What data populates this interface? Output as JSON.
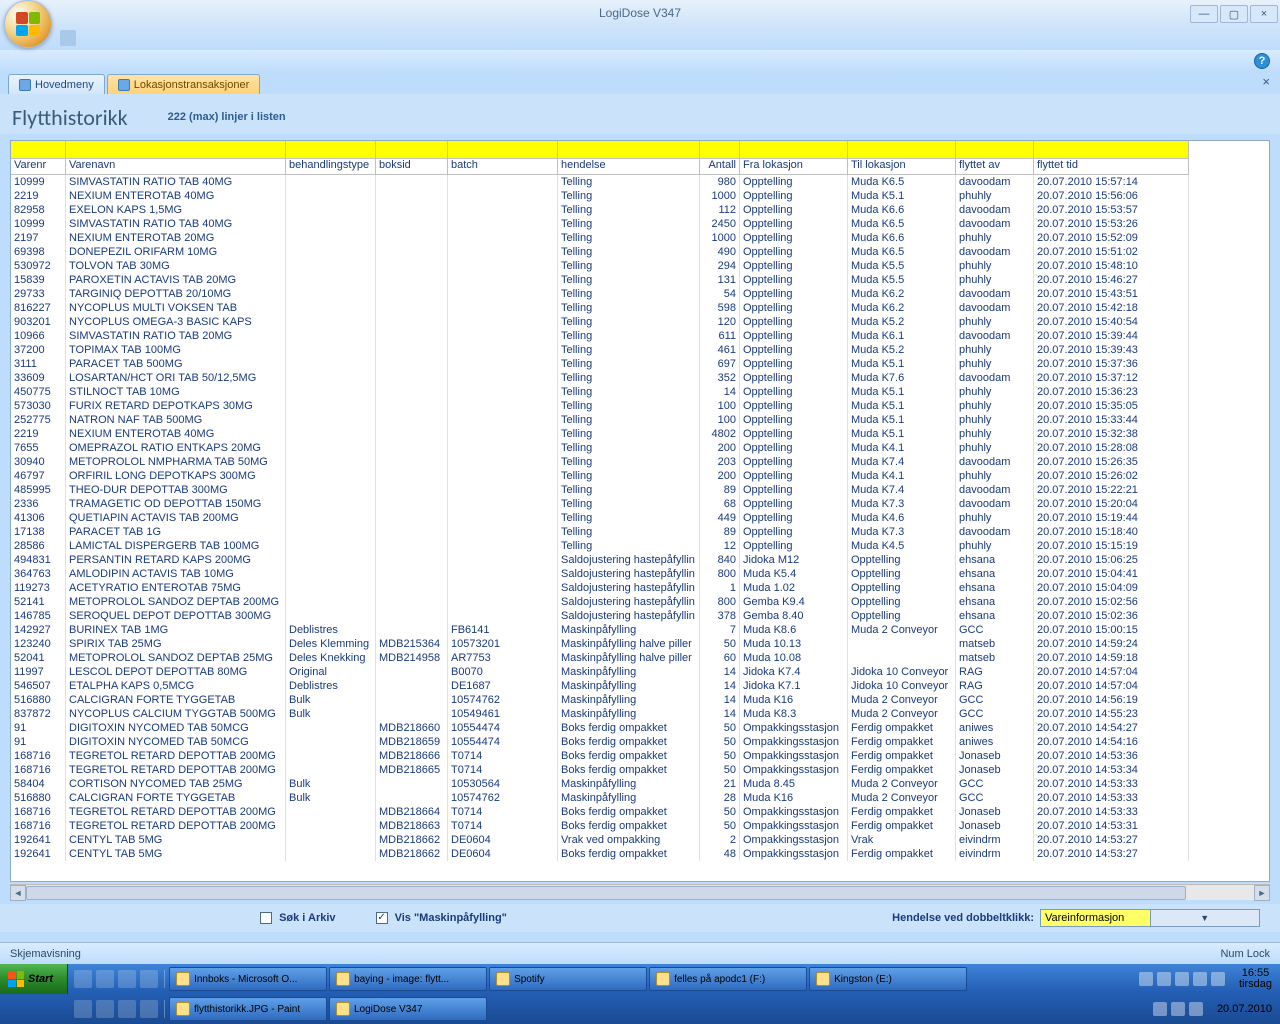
{
  "window": {
    "app_title": "LogiDose V347",
    "min": "—",
    "max": "▢",
    "close": "×",
    "help": "?"
  },
  "tabs": {
    "inactive": "Hovedmeny",
    "active": "Lokasjonstransaksjoner",
    "close": "×"
  },
  "heading": {
    "title": "Flytthistorikk",
    "subtitle": "222 (max) linjer i listen"
  },
  "columns": [
    "Varenr",
    "Varenavn",
    "behandlingstype",
    "boksid",
    "batch",
    "hendelse",
    "Antall",
    "Fra lokasjon",
    "Til lokasjon",
    "flyttet av",
    "flyttet tid"
  ],
  "rows": [
    [
      "10999",
      "SIMVASTATIN RATIO TAB 40MG",
      "",
      "",
      "",
      "Telling",
      "980",
      "Opptelling",
      "Muda K6.5",
      "davoodam",
      "20.07.2010 15:57:14"
    ],
    [
      "2219",
      "NEXIUM ENTEROTAB 40MG",
      "",
      "",
      "",
      "Telling",
      "1000",
      "Opptelling",
      "Muda K5.1",
      "phuhly",
      "20.07.2010 15:56:06"
    ],
    [
      "82958",
      "EXELON KAPS 1,5MG",
      "",
      "",
      "",
      "Telling",
      "112",
      "Opptelling",
      "Muda K6.6",
      "davoodam",
      "20.07.2010 15:53:57"
    ],
    [
      "10999",
      "SIMVASTATIN RATIO TAB 40MG",
      "",
      "",
      "",
      "Telling",
      "2450",
      "Opptelling",
      "Muda K6.5",
      "davoodam",
      "20.07.2010 15:53:26"
    ],
    [
      "2197",
      "NEXIUM ENTEROTAB 20MG",
      "",
      "",
      "",
      "Telling",
      "1000",
      "Opptelling",
      "Muda K6.6",
      "phuhly",
      "20.07.2010 15:52:09"
    ],
    [
      "69398",
      "DONEPEZIL ORIFARM 10MG",
      "",
      "",
      "",
      "Telling",
      "490",
      "Opptelling",
      "Muda K6.5",
      "davoodam",
      "20.07.2010 15:51:02"
    ],
    [
      "530972",
      "TOLVON TAB 30MG",
      "",
      "",
      "",
      "Telling",
      "294",
      "Opptelling",
      "Muda K5.5",
      "phuhly",
      "20.07.2010 15:48:10"
    ],
    [
      "15839",
      "PAROXETIN ACTAVIS TAB 20MG",
      "",
      "",
      "",
      "Telling",
      "131",
      "Opptelling",
      "Muda K5.5",
      "phuhly",
      "20.07.2010 15:46:27"
    ],
    [
      "29733",
      "TARGINIQ DEPOTTAB 20/10MG",
      "",
      "",
      "",
      "Telling",
      "54",
      "Opptelling",
      "Muda K6.2",
      "davoodam",
      "20.07.2010 15:43:51"
    ],
    [
      "816227",
      "NYCOPLUS MULTI VOKSEN TAB",
      "",
      "",
      "",
      "Telling",
      "598",
      "Opptelling",
      "Muda K6.2",
      "davoodam",
      "20.07.2010 15:42:18"
    ],
    [
      "903201",
      "NYCOPLUS OMEGA-3 BASIC KAPS",
      "",
      "",
      "",
      "Telling",
      "120",
      "Opptelling",
      "Muda K5.2",
      "phuhly",
      "20.07.2010 15:40:54"
    ],
    [
      "10966",
      "SIMVASTATIN RATIO TAB 20MG",
      "",
      "",
      "",
      "Telling",
      "611",
      "Opptelling",
      "Muda K6.1",
      "davoodam",
      "20.07.2010 15:39:44"
    ],
    [
      "37200",
      "TOPIMAX TAB 100MG",
      "",
      "",
      "",
      "Telling",
      "461",
      "Opptelling",
      "Muda K5.2",
      "phuhly",
      "20.07.2010 15:39:43"
    ],
    [
      "3111",
      "PARACET TAB  500MG",
      "",
      "",
      "",
      "Telling",
      "697",
      "Opptelling",
      "Muda K5.1",
      "phuhly",
      "20.07.2010 15:37:36"
    ],
    [
      "33609",
      "LOSARTAN/HCT ORI TAB 50/12,5MG",
      "",
      "",
      "",
      "Telling",
      "352",
      "Opptelling",
      "Muda K7.6",
      "davoodam",
      "20.07.2010 15:37:12"
    ],
    [
      "450775",
      "STILNOCT TAB 10MG",
      "",
      "",
      "",
      "Telling",
      "14",
      "Opptelling",
      "Muda K5.1",
      "phuhly",
      "20.07.2010 15:36:23"
    ],
    [
      "573030",
      "FURIX RETARD DEPOTKAPS 30MG",
      "",
      "",
      "",
      "Telling",
      "100",
      "Opptelling",
      "Muda K5.1",
      "phuhly",
      "20.07.2010 15:35:05"
    ],
    [
      "252775",
      "NATRON NAF TAB 500MG",
      "",
      "",
      "",
      "Telling",
      "100",
      "Opptelling",
      "Muda K5.1",
      "phuhly",
      "20.07.2010 15:33:44"
    ],
    [
      "2219",
      "NEXIUM ENTEROTAB 40MG",
      "",
      "",
      "",
      "Telling",
      "4802",
      "Opptelling",
      "Muda K5.1",
      "phuhly",
      "20.07.2010 15:32:38"
    ],
    [
      "7655",
      "OMEPRAZOL RATIO ENTKAPS 20MG",
      "",
      "",
      "",
      "Telling",
      "200",
      "Opptelling",
      "Muda K4.1",
      "phuhly",
      "20.07.2010 15:28:08"
    ],
    [
      "30940",
      "METOPROLOL NMPHARMA TAB  50MG",
      "",
      "",
      "",
      "Telling",
      "203",
      "Opptelling",
      "Muda K7.4",
      "davoodam",
      "20.07.2010 15:26:35"
    ],
    [
      "46797",
      "ORFIRIL LONG DEPOTKAPS 300MG",
      "",
      "",
      "",
      "Telling",
      "200",
      "Opptelling",
      "Muda K4.1",
      "phuhly",
      "20.07.2010 15:26:02"
    ],
    [
      "485995",
      "THEO-DUR DEPOTTAB 300MG",
      "",
      "",
      "",
      "Telling",
      "89",
      "Opptelling",
      "Muda K7.4",
      "davoodam",
      "20.07.2010 15:22:21"
    ],
    [
      "2336",
      "TRAMAGETIC OD DEPOTTAB 150MG",
      "",
      "",
      "",
      "Telling",
      "68",
      "Opptelling",
      "Muda K7.3",
      "davoodam",
      "20.07.2010 15:20:04"
    ],
    [
      "41306",
      "QUETIAPIN ACTAVIS TAB 200MG",
      "",
      "",
      "",
      "Telling",
      "449",
      "Opptelling",
      "Muda K4.6",
      "phuhly",
      "20.07.2010 15:19:44"
    ],
    [
      "17138",
      "PARACET TAB 1G",
      "",
      "",
      "",
      "Telling",
      "89",
      "Opptelling",
      "Muda K7.3",
      "davoodam",
      "20.07.2010 15:18:40"
    ],
    [
      "28586",
      "LAMICTAL DISPERGERB TAB 100MG",
      "",
      "",
      "",
      "Telling",
      "12",
      "Opptelling",
      "Muda K4.5",
      "phuhly",
      "20.07.2010 15:15:19"
    ],
    [
      "494831",
      "PERSANTIN RETARD KAPS 200MG",
      "",
      "",
      "",
      "Saldojustering hastepåfyllin",
      "840",
      "Jidoka M12",
      "Opptelling",
      "ehsana",
      "20.07.2010 15:06:25"
    ],
    [
      "364763",
      "AMLODIPIN ACTAVIS TAB 10MG",
      "",
      "",
      "",
      "Saldojustering hastepåfyllin",
      "800",
      "Muda K5.4",
      "Opptelling",
      "ehsana",
      "20.07.2010 15:04:41"
    ],
    [
      "119273",
      "ACETYRATIO ENTEROTAB 75MG",
      "",
      "",
      "",
      "Saldojustering hastepåfyllin",
      "1",
      "Muda 1.02",
      "Opptelling",
      "ehsana",
      "20.07.2010 15:04:09"
    ],
    [
      "52141",
      "METOPROLOL SANDOZ DEPTAB 200MG",
      "",
      "",
      "",
      "Saldojustering hastepåfyllin",
      "800",
      "Gemba K9.4",
      "Opptelling",
      "ehsana",
      "20.07.2010 15:02:56"
    ],
    [
      "146785",
      "SEROQUEL DEPOT DEPOTTAB 300MG",
      "",
      "",
      "",
      "Saldojustering hastepåfyllin",
      "378",
      "Gemba 8.40",
      "Opptelling",
      "ehsana",
      "20.07.2010 15:02:36"
    ],
    [
      "142927",
      "BURINEX TAB 1MG",
      "Deblistres",
      "",
      "FB6141",
      "Maskinpåfylling",
      "7",
      "Muda K8.6",
      "Muda 2 Conveyor",
      "GCC",
      "20.07.2010 15:00:15"
    ],
    [
      "123240",
      "SPIRIX TAB  25MG",
      "Deles Klemming",
      "MDB215364",
      "10573201",
      "Maskinpåfylling halve piller",
      "50",
      "Muda 10.13",
      "",
      "matseb",
      "20.07.2010 14:59:24"
    ],
    [
      "52041",
      "METOPROLOL SANDOZ DEPTAB  25MG",
      "Deles Knekking",
      "MDB214958",
      "AR7753",
      "Maskinpåfylling halve piller",
      "60",
      "Muda 10.08",
      "",
      "matseb",
      "20.07.2010 14:59:18"
    ],
    [
      "11997",
      "LESCOL DEPOT DEPOTTAB 80MG",
      "Original",
      "",
      "B0070",
      "Maskinpåfylling",
      "14",
      "Jidoka K7.4",
      "Jidoka 10 Conveyor",
      "RAG",
      "20.07.2010 14:57:04"
    ],
    [
      "546507",
      "ETALPHA KAPS 0,5MCG",
      "Deblistres",
      "",
      "DE1687",
      "Maskinpåfylling",
      "14",
      "Jidoka K7.1",
      "Jidoka 10 Conveyor",
      "RAG",
      "20.07.2010 14:57:04"
    ],
    [
      "516880",
      "CALCIGRAN FORTE TYGGETAB",
      "Bulk",
      "",
      "10574762",
      "Maskinpåfylling",
      "14",
      "Muda K16",
      "Muda 2 Conveyor",
      "GCC",
      "20.07.2010 14:56:19"
    ],
    [
      "837872",
      "NYCOPLUS CALCIUM TYGGTAB 500MG",
      "Bulk",
      "",
      "10549461",
      "Maskinpåfylling",
      "14",
      "Muda K8.3",
      "Muda 2 Conveyor",
      "GCC",
      "20.07.2010 14:55:23"
    ],
    [
      "91",
      "DIGITOXIN NYCOMED TAB 50MCG",
      "",
      "MDB218660",
      "10554474",
      "Boks ferdig ompakket",
      "50",
      "Ompakkingsstasjon",
      "Ferdig ompakket",
      "aniwes",
      "20.07.2010 14:54:27"
    ],
    [
      "91",
      "DIGITOXIN NYCOMED TAB 50MCG",
      "",
      "MDB218659",
      "10554474",
      "Boks ferdig ompakket",
      "50",
      "Ompakkingsstasjon",
      "Ferdig ompakket",
      "aniwes",
      "20.07.2010 14:54:16"
    ],
    [
      "168716",
      "TEGRETOL RETARD DEPOTTAB 200MG",
      "",
      "MDB218666",
      "T0714",
      "Boks ferdig ompakket",
      "50",
      "Ompakkingsstasjon",
      "Ferdig ompakket",
      "Jonaseb",
      "20.07.2010 14:53:36"
    ],
    [
      "168716",
      "TEGRETOL RETARD DEPOTTAB 200MG",
      "",
      "MDB218665",
      "T0714",
      "Boks ferdig ompakket",
      "50",
      "Ompakkingsstasjon",
      "Ferdig ompakket",
      "Jonaseb",
      "20.07.2010 14:53:34"
    ],
    [
      "58404",
      "CORTISON NYCOMED TAB 25MG",
      "Bulk",
      "",
      "10530564",
      "Maskinpåfylling",
      "21",
      "Muda 8.45",
      "Muda 2 Conveyor",
      "GCC",
      "20.07.2010 14:53:33"
    ],
    [
      "516880",
      "CALCIGRAN FORTE TYGGETAB",
      "Bulk",
      "",
      "10574762",
      "Maskinpåfylling",
      "28",
      "Muda K16",
      "Muda 2 Conveyor",
      "GCC",
      "20.07.2010 14:53:33"
    ],
    [
      "168716",
      "TEGRETOL RETARD DEPOTTAB 200MG",
      "",
      "MDB218664",
      "T0714",
      "Boks ferdig ompakket",
      "50",
      "Ompakkingsstasjon",
      "Ferdig ompakket",
      "Jonaseb",
      "20.07.2010 14:53:33"
    ],
    [
      "168716",
      "TEGRETOL RETARD DEPOTTAB 200MG",
      "",
      "MDB218663",
      "T0714",
      "Boks ferdig ompakket",
      "50",
      "Ompakkingsstasjon",
      "Ferdig ompakket",
      "Jonaseb",
      "20.07.2010 14:53:31"
    ],
    [
      "192641",
      "CENTYL TAB 5MG",
      "",
      "MDB218662",
      "DE0604",
      "Vrak ved ompakking",
      "2",
      "Ompakkingsstasjon",
      "Vrak",
      "eivindrm",
      "20.07.2010 14:53:27"
    ],
    [
      "192641",
      "CENTYL TAB 5MG",
      "",
      "MDB218662",
      "DE0604",
      "Boks ferdig ompakket",
      "48",
      "Ompakkingsstasjon",
      "Ferdig ompakket",
      "eivindrm",
      "20.07.2010 14:53:27"
    ]
  ],
  "options": {
    "archive_label": "Søk i Arkiv",
    "show_fill_label": "Vis \"Maskinpåfylling\"",
    "dblclick_label": "Hendelse ved dobbeltklikk:",
    "combo_value": "Vareinformasjon"
  },
  "statusbar": {
    "left": "Skjemavisning",
    "right": "Num Lock"
  },
  "taskbar": {
    "start": "Start",
    "row1": [
      {
        "label": "Innboks - Microsoft O..."
      },
      {
        "label": "baying - image: flytt..."
      },
      {
        "label": "Spotify"
      },
      {
        "label": "felles på apodc1 (F:)"
      },
      {
        "label": "Kingston (E:)"
      }
    ],
    "row2": [
      {
        "label": "flytthistorikk.JPG - Paint"
      },
      {
        "label": "LogiDose V347"
      }
    ],
    "clock_time": "16:55",
    "clock_day": "tirsdag",
    "clock_date": "20.07.2010"
  }
}
